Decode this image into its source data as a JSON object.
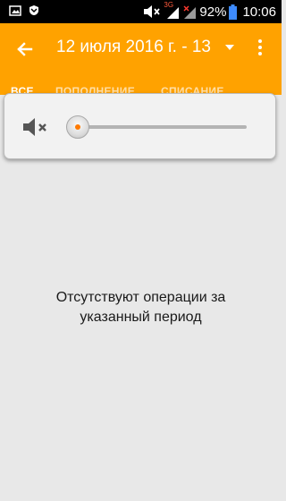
{
  "status_bar": {
    "battery_percent": "92%",
    "time": "10:06",
    "network_label": "3G",
    "icons": [
      "image-notification-icon",
      "shield-notification-icon",
      "volume-mute-icon",
      "signal-3g-icon",
      "signal-icon",
      "battery-icon"
    ]
  },
  "app_bar": {
    "date_range": "12 июля 2016 г. - 13",
    "back_icon": "arrow-left-icon",
    "menu_icon": "more-vert-icon"
  },
  "tabs": [
    {
      "label": "ВСЕ",
      "active": true
    },
    {
      "label": "ПОПОЛНЕНИЕ",
      "active": false
    },
    {
      "label": "СПИСАНИЕ",
      "active": false
    }
  ],
  "volume_panel": {
    "level": 0,
    "muted": true,
    "accent_color": "#ff7a00"
  },
  "main": {
    "empty_message": "Отсутствуют операции за\nуказанный период"
  },
  "colors": {
    "accent": "#ffa200",
    "background": "#e8e8e8"
  }
}
